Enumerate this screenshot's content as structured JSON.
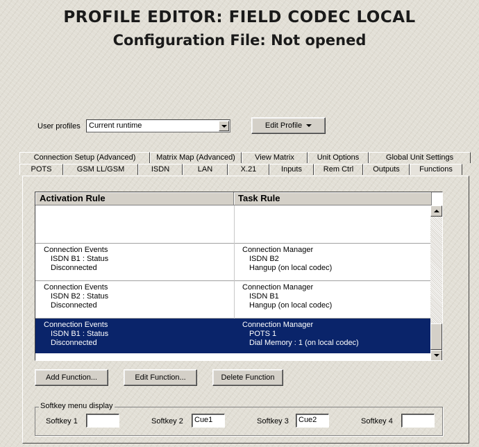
{
  "header": {
    "title_line1": "PROFILE EDITOR:  FIELD CODEC LOCAL",
    "title_line2": "Configuration File: Not opened"
  },
  "profiles": {
    "label": "User profiles",
    "selected": "Current runtime",
    "edit_button": "Edit Profile"
  },
  "tabs": {
    "row1": [
      "Connection Setup (Advanced)",
      "Matrix Map (Advanced)",
      "View Matrix",
      "Unit Options",
      "Global Unit Settings"
    ],
    "row2": [
      "POTS",
      "GSM LL/GSM",
      "ISDN",
      "LAN",
      "X.21",
      "Inputs",
      "Rem Ctrl",
      "Outputs",
      "Functions"
    ],
    "active": "Functions"
  },
  "table": {
    "col_activation": "Activation Rule",
    "col_task": "Task Rule",
    "rows": [
      {
        "activation": [
          "",
          "",
          ""
        ],
        "task": [
          "",
          "",
          ""
        ],
        "selected": false
      },
      {
        "activation": [
          "Connection Events",
          "ISDN B1 : Status",
          "Disconnected"
        ],
        "task": [
          "Connection Manager",
          "ISDN B2",
          "Hangup (on local codec)"
        ],
        "selected": false
      },
      {
        "activation": [
          "Connection Events",
          "ISDN B2 : Status",
          "Disconnected"
        ],
        "task": [
          "Connection Manager",
          "ISDN B1",
          "Hangup (on local codec)"
        ],
        "selected": false
      },
      {
        "activation": [
          "Connection Events",
          "ISDN B1 : Status",
          "Disconnected"
        ],
        "task": [
          "Connection Manager",
          "POTS 1",
          "Dial Memory : 1 (on local codec)"
        ],
        "selected": true
      }
    ]
  },
  "buttons": {
    "add": "Add Function...",
    "edit": "Edit Function...",
    "delete": "Delete Function"
  },
  "softkeys": {
    "group_label": "Softkey menu display",
    "items": [
      {
        "label": "Softkey 1",
        "value": ""
      },
      {
        "label": "Softkey 2",
        "value": "Cue1"
      },
      {
        "label": "Softkey 3",
        "value": "Cue2"
      },
      {
        "label": "Softkey 4",
        "value": ""
      }
    ]
  },
  "colors": {
    "selection": "#0a246a",
    "face": "#d4d0c8"
  },
  "icons": [
    "dropdown-arrow-icon",
    "scroll-up-arrow-icon",
    "scroll-down-arrow-icon"
  ]
}
